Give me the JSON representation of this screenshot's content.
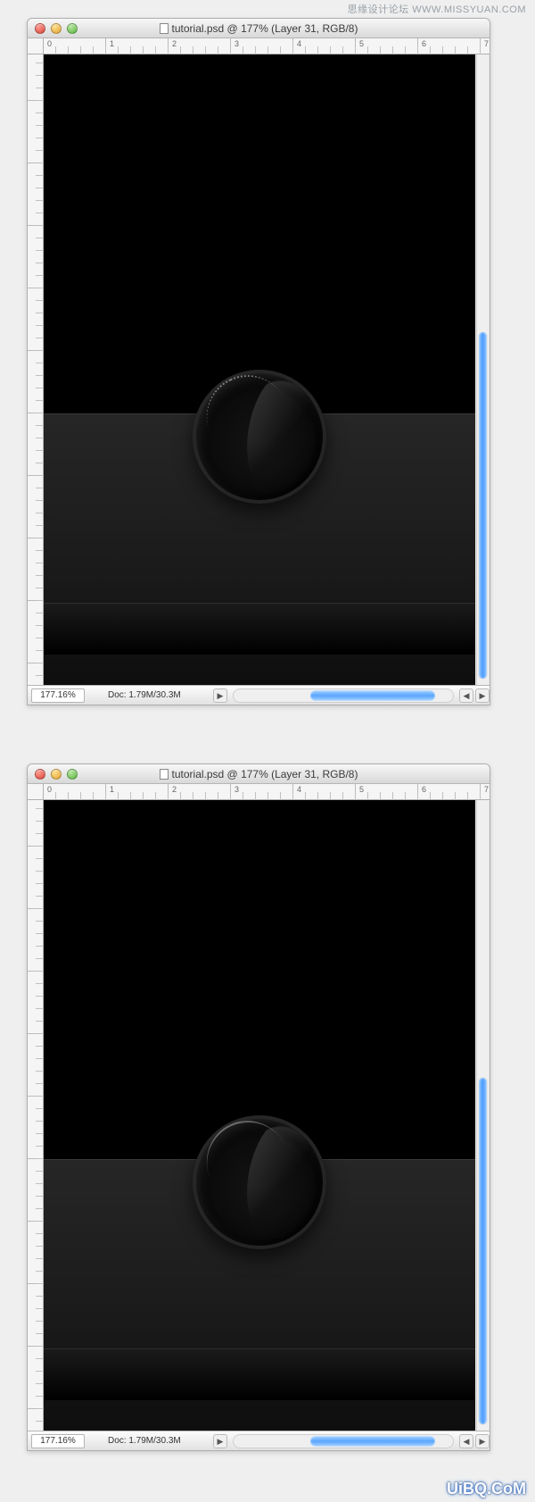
{
  "watermarks": {
    "top": "思缘设计论坛  WWW.MISSYUAN.COM",
    "bottom": "UiBQ.CoM"
  },
  "window": {
    "title": "tutorial.psd @ 177% (Layer 31, RGB/8)"
  },
  "status": {
    "zoom": "177.16%",
    "doc": "Doc: 1.79M/30.3M"
  },
  "ruler": {
    "h": [
      "0",
      "1",
      "2",
      "3",
      "4",
      "5",
      "6",
      "7"
    ]
  },
  "icons": {
    "doc": "document-icon",
    "play": "▶",
    "left": "◀",
    "right": "▶"
  }
}
